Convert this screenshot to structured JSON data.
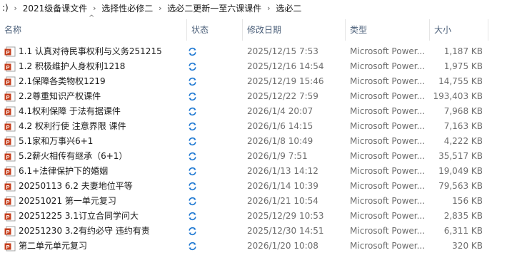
{
  "breadcrumb": {
    "items": [
      ":)",
      "2021级备课文件",
      "选择性必修二",
      "选必二更新一至六课课件",
      "选必二"
    ],
    "separator": "›"
  },
  "columns": {
    "name": "名称",
    "status": "状态",
    "date": "修改日期",
    "type": "类型",
    "size": "大小"
  },
  "icons": {
    "file": "powerpoint-file-icon",
    "status": "sync-pending-icon"
  },
  "colors": {
    "ppt_red": "#c43e1c",
    "sync_blue": "#1e78d2",
    "header_text": "#4c607a"
  },
  "files": [
    {
      "name": "1.1 认真对待民事权利与义务251215",
      "date": "2025/12/15 7:53",
      "type": "Microsoft Power...",
      "size": "1,187 KB"
    },
    {
      "name": "1.2 积极维护人身权利1218",
      "date": "2025/12/16 14:54",
      "type": "Microsoft Power...",
      "size": "1,975 KB"
    },
    {
      "name": "2.1保障各类物权1219",
      "date": "2025/12/19 15:46",
      "type": "Microsoft Power...",
      "size": "14,755 KB"
    },
    {
      "name": "2.2尊重知识产权课件",
      "date": "2025/12/22 7:59",
      "type": "Microsoft Power...",
      "size": "193,403 KB"
    },
    {
      "name": "4.1权利保障 于法有据课件",
      "date": "2026/1/4 20:07",
      "type": "Microsoft Power...",
      "size": "7,968 KB"
    },
    {
      "name": "4.2 权利行使 注意界限 课件",
      "date": "2026/1/6 14:15",
      "type": "Microsoft Power...",
      "size": "7,163 KB"
    },
    {
      "name": "5.1家和万事兴6+1",
      "date": "2026/1/8 10:49",
      "type": "Microsoft Power...",
      "size": "4,222 KB"
    },
    {
      "name": "5.2薪火相传有继承（6+1）",
      "date": "2026/1/9 7:51",
      "type": "Microsoft Power...",
      "size": "35,517 KB"
    },
    {
      "name": "6.1+法律保护下的婚姻",
      "date": "2026/1/13 14:12",
      "type": "Microsoft Power...",
      "size": "19,049 KB"
    },
    {
      "name": "20250113 6.2 夫妻地位平等",
      "date": "2026/1/14 10:39",
      "type": "Microsoft Power...",
      "size": "79,563 KB"
    },
    {
      "name": "20251021 第一单元复习",
      "date": "2026/1/21 10:54",
      "type": "Microsoft Power...",
      "size": "156 KB"
    },
    {
      "name": "20251225  3.1订立合同学问大",
      "date": "2025/12/29 10:53",
      "type": "Microsoft Power...",
      "size": "2,835 KB"
    },
    {
      "name": "20251230  3.2有约必守  违约有责",
      "date": "2025/12/30 14:51",
      "type": "Microsoft Power...",
      "size": "6,311 KB"
    },
    {
      "name": "第二单元单元复习",
      "date": "2026/1/20 10:08",
      "type": "Microsoft Power...",
      "size": "320 KB"
    }
  ]
}
